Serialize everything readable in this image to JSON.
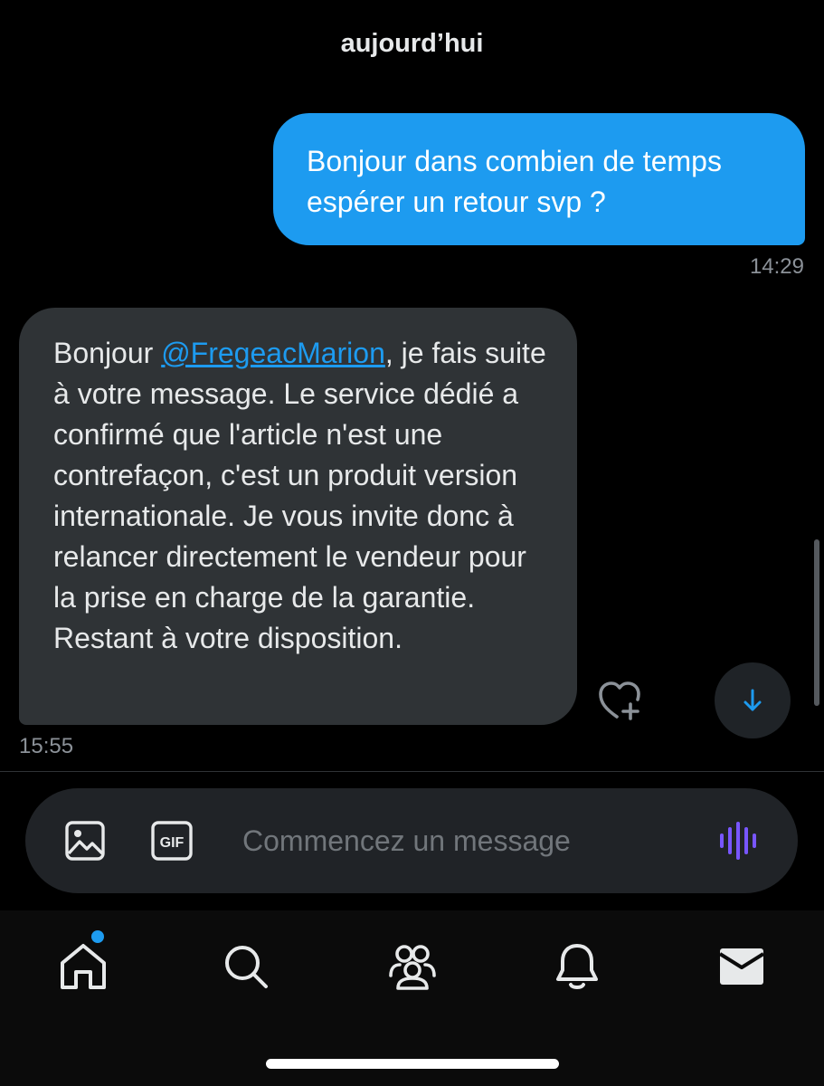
{
  "conversation": {
    "date_separator": "aujourd’hui",
    "messages": [
      {
        "direction": "sent",
        "text": "Bonjour dans combien de temps espérer un retour svp ?",
        "time": "14:29"
      },
      {
        "direction": "received",
        "text_before_mention": "Bonjour ",
        "mention": "@FregeacMarion",
        "text_after_mention": ", je fais suite à votre message. Le service dédié a confirmé que l'article n'est une contrefaçon, c'est un produit version internationale. Je vous invite donc à relancer directement le vendeur pour la prise en charge de la garantie. Restant à votre disposition.",
        "time": "15:55"
      }
    ]
  },
  "composer": {
    "placeholder": "Commencez un message",
    "value": ""
  },
  "icons": {
    "react": "heart-plus-icon",
    "scroll_down": "arrow-down-icon",
    "media": "image-icon",
    "gif": "gif-icon",
    "voice": "voice-waveform-icon",
    "nav": [
      "home-icon",
      "search-icon",
      "communities-icon",
      "bell-icon",
      "mail-icon"
    ]
  },
  "colors": {
    "accent": "#1d9bf0",
    "received_bubble": "#2f3336",
    "voice": "#7856ff",
    "background": "#000000"
  }
}
